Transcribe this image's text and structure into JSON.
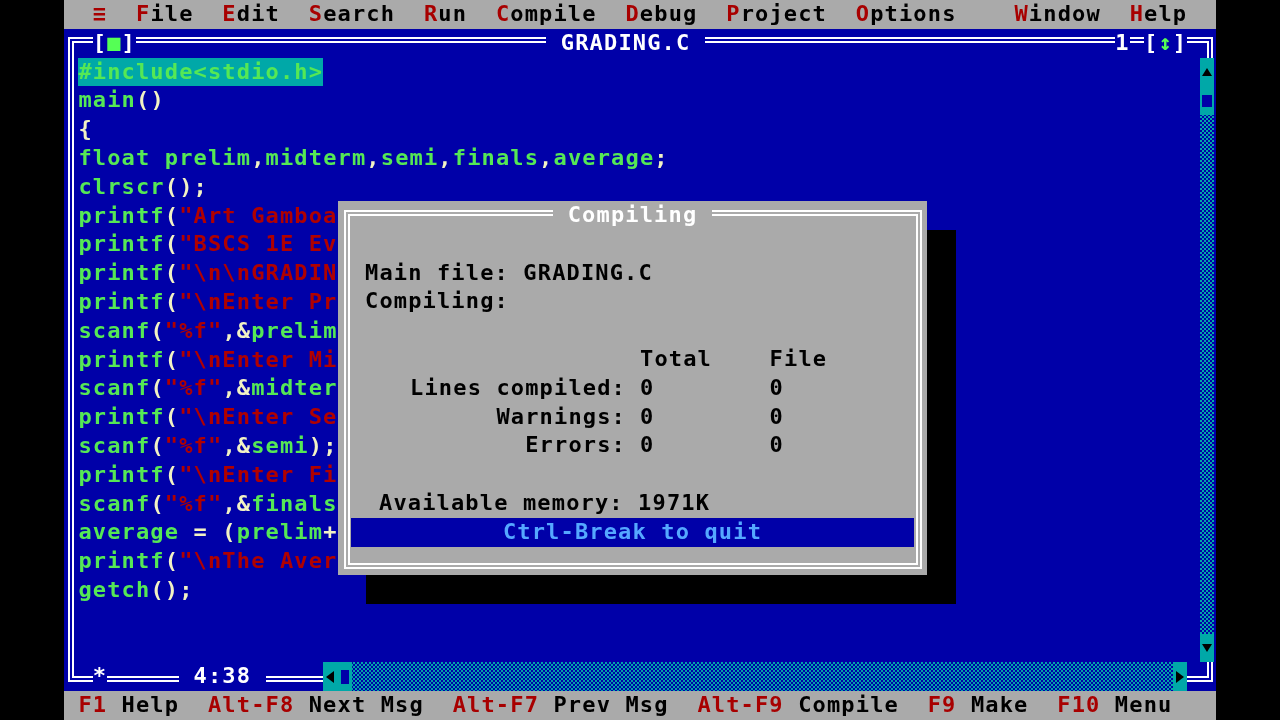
{
  "menu_bar": {
    "system_menu": "≡",
    "items": [
      {
        "hotkey": "F",
        "rest": "ile"
      },
      {
        "hotkey": "E",
        "rest": "dit"
      },
      {
        "hotkey": "S",
        "rest": "earch"
      },
      {
        "hotkey": "R",
        "rest": "un"
      },
      {
        "hotkey": "C",
        "rest": "ompile"
      },
      {
        "hotkey": "D",
        "rest": "ebug"
      },
      {
        "hotkey": "P",
        "rest": "roject"
      },
      {
        "hotkey": "O",
        "rest": "ptions"
      }
    ],
    "right_items": [
      {
        "hotkey": "W",
        "rest": "indow"
      },
      {
        "hotkey": "H",
        "rest": "elp"
      }
    ]
  },
  "editor": {
    "close_box": {
      "open": "[",
      "glyph": "■",
      "close": "]"
    },
    "title": "GRADING.C",
    "window_number": "1",
    "zoom_box": {
      "open": "[",
      "glyph": "↕",
      "close": "]"
    },
    "lines": [
      {
        "selected": true,
        "tokens": [
          {
            "kind": "ident",
            "text": "#include<stdio.h>"
          }
        ]
      },
      {
        "selected": false,
        "tokens": [
          {
            "kind": "ident",
            "text": "main"
          },
          {
            "kind": "punct",
            "text": "()"
          }
        ]
      },
      {
        "selected": false,
        "tokens": [
          {
            "kind": "punct",
            "text": "{"
          }
        ]
      },
      {
        "selected": false,
        "tokens": [
          {
            "kind": "ident",
            "text": "float prelim"
          },
          {
            "kind": "punct",
            "text": ","
          },
          {
            "kind": "ident",
            "text": "midterm"
          },
          {
            "kind": "punct",
            "text": ","
          },
          {
            "kind": "ident",
            "text": "semi"
          },
          {
            "kind": "punct",
            "text": ","
          },
          {
            "kind": "ident",
            "text": "finals"
          },
          {
            "kind": "punct",
            "text": ","
          },
          {
            "kind": "ident",
            "text": "average"
          },
          {
            "kind": "punct",
            "text": ";"
          }
        ]
      },
      {
        "selected": false,
        "tokens": [
          {
            "kind": "ident",
            "text": "clrscr"
          },
          {
            "kind": "punct",
            "text": "();"
          }
        ]
      },
      {
        "selected": false,
        "tokens": [
          {
            "kind": "ident",
            "text": "printf"
          },
          {
            "kind": "punct",
            "text": "("
          },
          {
            "kind": "string",
            "text": "\"Art Gamboa"
          }
        ]
      },
      {
        "selected": false,
        "tokens": [
          {
            "kind": "ident",
            "text": "printf"
          },
          {
            "kind": "punct",
            "text": "("
          },
          {
            "kind": "string",
            "text": "\"BSCS 1E Ev"
          }
        ]
      },
      {
        "selected": false,
        "tokens": [
          {
            "kind": "ident",
            "text": "printf"
          },
          {
            "kind": "punct",
            "text": "("
          },
          {
            "kind": "string",
            "text": "\"\\n\\nGRADIN"
          }
        ]
      },
      {
        "selected": false,
        "tokens": [
          {
            "kind": "ident",
            "text": "printf"
          },
          {
            "kind": "punct",
            "text": "("
          },
          {
            "kind": "string",
            "text": "\"\\nEnter Pr"
          }
        ]
      },
      {
        "selected": false,
        "tokens": [
          {
            "kind": "ident",
            "text": "scanf"
          },
          {
            "kind": "punct",
            "text": "("
          },
          {
            "kind": "string",
            "text": "\"%f\""
          },
          {
            "kind": "punct",
            "text": ",&"
          },
          {
            "kind": "ident",
            "text": "prelim"
          }
        ]
      },
      {
        "selected": false,
        "tokens": [
          {
            "kind": "ident",
            "text": "printf"
          },
          {
            "kind": "punct",
            "text": "("
          },
          {
            "kind": "string",
            "text": "\"\\nEnter Mi"
          }
        ]
      },
      {
        "selected": false,
        "tokens": [
          {
            "kind": "ident",
            "text": "scanf"
          },
          {
            "kind": "punct",
            "text": "("
          },
          {
            "kind": "string",
            "text": "\"%f\""
          },
          {
            "kind": "punct",
            "text": ",&"
          },
          {
            "kind": "ident",
            "text": "midter"
          }
        ]
      },
      {
        "selected": false,
        "tokens": [
          {
            "kind": "ident",
            "text": "printf"
          },
          {
            "kind": "punct",
            "text": "("
          },
          {
            "kind": "string",
            "text": "\"\\nEnter Se"
          }
        ]
      },
      {
        "selected": false,
        "tokens": [
          {
            "kind": "ident",
            "text": "scanf"
          },
          {
            "kind": "punct",
            "text": "("
          },
          {
            "kind": "string",
            "text": "\"%f\""
          },
          {
            "kind": "punct",
            "text": ",&"
          },
          {
            "kind": "ident",
            "text": "semi"
          },
          {
            "kind": "punct",
            "text": ");"
          }
        ]
      },
      {
        "selected": false,
        "tokens": [
          {
            "kind": "ident",
            "text": "printf"
          },
          {
            "kind": "punct",
            "text": "("
          },
          {
            "kind": "string",
            "text": "\"\\nEnter Fi"
          }
        ]
      },
      {
        "selected": false,
        "tokens": [
          {
            "kind": "ident",
            "text": "scanf"
          },
          {
            "kind": "punct",
            "text": "("
          },
          {
            "kind": "string",
            "text": "\"%f\""
          },
          {
            "kind": "punct",
            "text": ",&"
          },
          {
            "kind": "ident",
            "text": "finals"
          }
        ]
      },
      {
        "selected": false,
        "tokens": [
          {
            "kind": "ident",
            "text": "average"
          },
          {
            "kind": "punct",
            "text": " = ("
          },
          {
            "kind": "ident",
            "text": "prelim"
          },
          {
            "kind": "punct",
            "text": "+"
          }
        ]
      },
      {
        "selected": false,
        "tokens": [
          {
            "kind": "ident",
            "text": "printf"
          },
          {
            "kind": "punct",
            "text": "("
          },
          {
            "kind": "string",
            "text": "\"\\nThe Aver"
          }
        ]
      },
      {
        "selected": false,
        "tokens": [
          {
            "kind": "ident",
            "text": "getch"
          },
          {
            "kind": "punct",
            "text": "();"
          }
        ]
      }
    ],
    "modified_mark": "*",
    "cursor_position": "4:38"
  },
  "dialog": {
    "title": "Compiling",
    "main_file_label": "Main file:",
    "main_file": "GRADING.C",
    "compiling_label": "Compiling:",
    "columns": [
      "Total",
      "File"
    ],
    "stats": [
      {
        "label": "Lines compiled:",
        "total": "0",
        "file": "0"
      },
      {
        "label": "Warnings:",
        "total": "0",
        "file": "0"
      },
      {
        "label": "Errors:",
        "total": "0",
        "file": "0"
      }
    ],
    "memory_label": "Available memory:",
    "memory": "1971K",
    "footer": "Ctrl-Break to quit"
  },
  "status_bar": [
    {
      "key": "F1",
      "label": "Help"
    },
    {
      "key": "Alt-F8",
      "label": "Next Msg"
    },
    {
      "key": "Alt-F7",
      "label": "Prev Msg"
    },
    {
      "key": "Alt-F9",
      "label": "Compile"
    },
    {
      "key": "F9",
      "label": "Make"
    },
    {
      "key": "F10",
      "label": "Menu"
    }
  ]
}
